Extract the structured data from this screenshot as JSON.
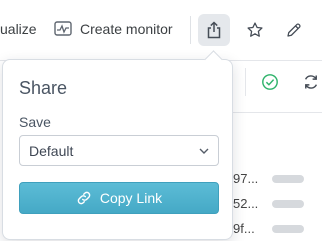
{
  "toolbar": {
    "visualize_label": "ualize",
    "create_monitor_label": "Create monitor",
    "share_icon": "share-upload-icon",
    "star_icon": "star-icon",
    "edit_icon": "pencil-icon"
  },
  "secondary_toolbar": {
    "status_icon": "check-circle-icon",
    "refresh_icon": "refresh-icon"
  },
  "background_rows": [
    {
      "id": "97..."
    },
    {
      "id": "52..."
    },
    {
      "id": "9f..."
    }
  ],
  "share_popover": {
    "title": "Share",
    "save_label": "Save",
    "save_selected": "Default",
    "copy_link_label": "Copy Link"
  },
  "colors": {
    "accent": "#4bb0cc",
    "success": "#2fb36b"
  }
}
